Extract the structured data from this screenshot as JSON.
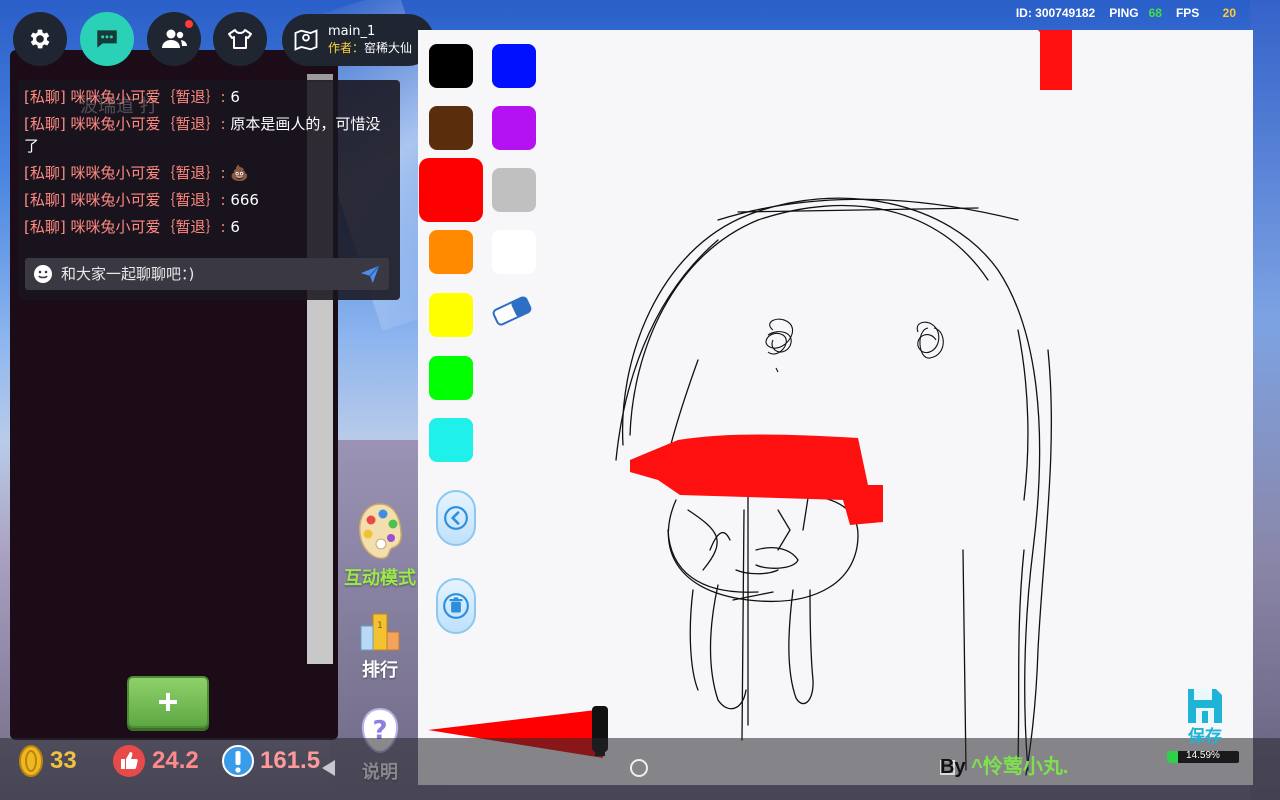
{
  "toolbar": {
    "buttons": [
      {
        "icon": "gear-icon"
      },
      {
        "icon": "chat-icon",
        "active": true
      },
      {
        "icon": "friends-icon",
        "has_notification": true
      },
      {
        "icon": "outfit-icon"
      }
    ],
    "map": {
      "icon": "map-pin-icon",
      "name": "main_1",
      "author_label": "作者：",
      "author": "窑稀大仙"
    }
  },
  "hud": {
    "id_text": "ID: 300749182",
    "ping_label": "PING",
    "ping_value": "68",
    "fps_label": "FPS",
    "fps_value": "20"
  },
  "chat": {
    "ghost_tabs": "波瑞道     打",
    "messages": [
      {
        "channel": "[私聊]",
        "sender": "咪咪兔小可爱｛暂退｝:",
        "text": "6"
      },
      {
        "channel": "[私聊]",
        "sender": "咪咪兔小可爱｛暂退｝:",
        "text": "原本是画人的，可惜没了"
      },
      {
        "channel": "[私聊]",
        "sender": "咪咪兔小可爱｛暂退｝:",
        "text": "💩"
      },
      {
        "channel": "[私聊]",
        "sender": "咪咪兔小可爱｛暂退｝:",
        "text": "666"
      },
      {
        "channel": "[私聊]",
        "sender": "咪咪兔小可爱｛暂退｝:",
        "text": "6"
      }
    ],
    "input_placeholder": "和大家一起聊聊吧：)"
  },
  "side_actions": {
    "interactive": "互动模式",
    "ranking": "排行",
    "help": "说明"
  },
  "stats": {
    "coins": "33",
    "likes": "24.2",
    "alerts": "161.5"
  },
  "palette": {
    "colors": [
      "#000000",
      "#0011ff",
      "#5a2d0c",
      "#b412f2",
      "#ff0000",
      "#c0c0c0",
      "#ff8a00",
      "#ffffff",
      "#ffff00",
      "#00ff00",
      "#1ff0ea"
    ],
    "selected": "#ff0000"
  },
  "board": {
    "save_label": "保存",
    "progress_text": "14.59%",
    "progress": 0.1459,
    "credit_by": "By",
    "credit_name": "^怜莺小丸."
  }
}
